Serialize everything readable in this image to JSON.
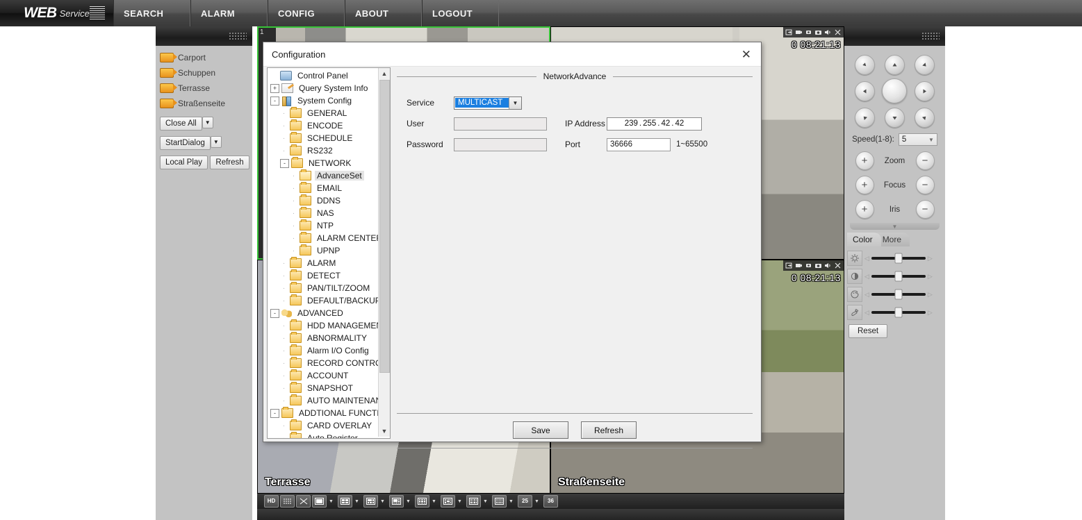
{
  "topnav": {
    "logo_web": "WEB",
    "logo_service": "Service",
    "items": [
      {
        "label": "SEARCH",
        "name": "nav-search"
      },
      {
        "label": "ALARM",
        "name": "nav-alarm"
      },
      {
        "label": "CONFIG",
        "name": "nav-config"
      },
      {
        "label": "ABOUT",
        "name": "nav-about"
      },
      {
        "label": "LOGOUT",
        "name": "nav-logout"
      }
    ]
  },
  "sidebar": {
    "cameras": [
      {
        "label": "Carport"
      },
      {
        "label": "Schuppen"
      },
      {
        "label": "Terrasse"
      },
      {
        "label": "Straßenseite"
      }
    ],
    "close_all": "Close All",
    "start_dialog": "StartDialog",
    "local_play": "Local Play",
    "refresh": "Refresh"
  },
  "videos": {
    "cells": [
      {
        "name": "",
        "time": "0 08:21:13",
        "num": "1"
      },
      {
        "name": "",
        "time": "0 08:21:13",
        "num": ""
      },
      {
        "name": "Terrasse",
        "time": "",
        "num": ""
      },
      {
        "name": "Straßenseite",
        "time": "",
        "num": ""
      }
    ]
  },
  "toolbar": {
    "hd_label": "HD",
    "buttons": [
      "hd",
      "fluency",
      "fullscreen",
      "layout-1",
      "layout-4",
      "layout-6",
      "layout-8",
      "layout-9",
      "layout-13",
      "layout-16",
      "layout-20",
      "layout-25",
      "layout-36"
    ],
    "label_25": "25",
    "label_36": "36"
  },
  "ptz": {
    "speed_label": "Speed(1-8):",
    "speed_value": "5",
    "zoom_label": "Zoom",
    "focus_label": "Focus",
    "iris_label": "Iris",
    "plus": "+",
    "minus": "−",
    "tab_color": "Color",
    "tab_more": "More",
    "reset_label": "Reset",
    "sliders": [
      {
        "icon": "brightness-icon"
      },
      {
        "icon": "contrast-icon"
      },
      {
        "icon": "hue-icon"
      },
      {
        "icon": "saturation-icon"
      }
    ]
  },
  "dialog": {
    "title": "Configuration",
    "close": "✕",
    "legend": "NetworkAdvance",
    "form": {
      "service_label": "Service",
      "service_value": "MULTICAST",
      "user_label": "User",
      "user_value": "",
      "password_label": "Password",
      "password_value": "",
      "ip_label": "IP Address",
      "ip_octets": [
        "239",
        "255",
        "42",
        "42"
      ],
      "port_label": "Port",
      "port_value": "36666",
      "port_hint": "1~65500"
    },
    "save_label": "Save",
    "refresh_label": "Refresh",
    "tree": [
      {
        "label": "Control Panel",
        "level": 0,
        "icon": "monitor",
        "toggle": "",
        "sel": false
      },
      {
        "label": "Query System Info",
        "level": 0,
        "icon": "note",
        "toggle": "+",
        "sel": false
      },
      {
        "label": "System Config",
        "level": 0,
        "icon": "tool",
        "toggle": "-",
        "sel": false
      },
      {
        "label": "GENERAL",
        "level": 1,
        "icon": "folder",
        "toggle": "",
        "sel": false
      },
      {
        "label": "ENCODE",
        "level": 1,
        "icon": "folder",
        "toggle": "",
        "sel": false
      },
      {
        "label": "SCHEDULE",
        "level": 1,
        "icon": "folder",
        "toggle": "",
        "sel": false
      },
      {
        "label": "RS232",
        "level": 1,
        "icon": "folder",
        "toggle": "",
        "sel": false
      },
      {
        "label": "NETWORK",
        "level": 1,
        "icon": "folder",
        "toggle": "-",
        "sel": false
      },
      {
        "label": "AdvanceSet",
        "level": 2,
        "icon": "folder-open",
        "toggle": "",
        "sel": true
      },
      {
        "label": "EMAIL",
        "level": 2,
        "icon": "folder",
        "toggle": "",
        "sel": false
      },
      {
        "label": "DDNS",
        "level": 2,
        "icon": "folder",
        "toggle": "",
        "sel": false
      },
      {
        "label": "NAS",
        "level": 2,
        "icon": "folder",
        "toggle": "",
        "sel": false
      },
      {
        "label": "NTP",
        "level": 2,
        "icon": "folder",
        "toggle": "",
        "sel": false
      },
      {
        "label": "ALARM CENTER",
        "level": 2,
        "icon": "folder",
        "toggle": "",
        "sel": false
      },
      {
        "label": "UPNP",
        "level": 2,
        "icon": "folder",
        "toggle": "",
        "sel": false
      },
      {
        "label": "ALARM",
        "level": 1,
        "icon": "folder",
        "toggle": "",
        "sel": false
      },
      {
        "label": "DETECT",
        "level": 1,
        "icon": "folder",
        "toggle": "",
        "sel": false
      },
      {
        "label": "PAN/TILT/ZOOM",
        "level": 1,
        "icon": "folder",
        "toggle": "",
        "sel": false
      },
      {
        "label": "DEFAULT/BACKUP",
        "level": 1,
        "icon": "folder",
        "toggle": "",
        "sel": false
      },
      {
        "label": "ADVANCED",
        "level": 0,
        "icon": "gears",
        "toggle": "-",
        "sel": false
      },
      {
        "label": "HDD MANAGEMENT",
        "level": 1,
        "icon": "folder",
        "toggle": "",
        "sel": false
      },
      {
        "label": "ABNORMALITY",
        "level": 1,
        "icon": "folder",
        "toggle": "",
        "sel": false
      },
      {
        "label": "Alarm I/O Config",
        "level": 1,
        "icon": "folder",
        "toggle": "",
        "sel": false
      },
      {
        "label": "RECORD CONTROL",
        "level": 1,
        "icon": "folder",
        "toggle": "",
        "sel": false
      },
      {
        "label": "ACCOUNT",
        "level": 1,
        "icon": "folder",
        "toggle": "",
        "sel": false
      },
      {
        "label": "SNAPSHOT",
        "level": 1,
        "icon": "folder",
        "toggle": "",
        "sel": false
      },
      {
        "label": "AUTO MAINTENANCE",
        "level": 1,
        "icon": "folder",
        "toggle": "",
        "sel": false
      },
      {
        "label": "ADDTIONAL FUNCTION",
        "level": 0,
        "icon": "folder",
        "toggle": "-",
        "sel": false
      },
      {
        "label": "CARD OVERLAY",
        "level": 1,
        "icon": "folder",
        "toggle": "",
        "sel": false
      },
      {
        "label": "Auto Register",
        "level": 1,
        "icon": "folder",
        "toggle": "",
        "sel": false
      }
    ]
  },
  "colors": {
    "accent": "#1b7fe0",
    "panel": "#c3c3c3",
    "dialog_bg": "#f0f0f0",
    "folder": "#f6c75a",
    "camera_icon": "#e8921c",
    "selection_green": "#38c438"
  }
}
